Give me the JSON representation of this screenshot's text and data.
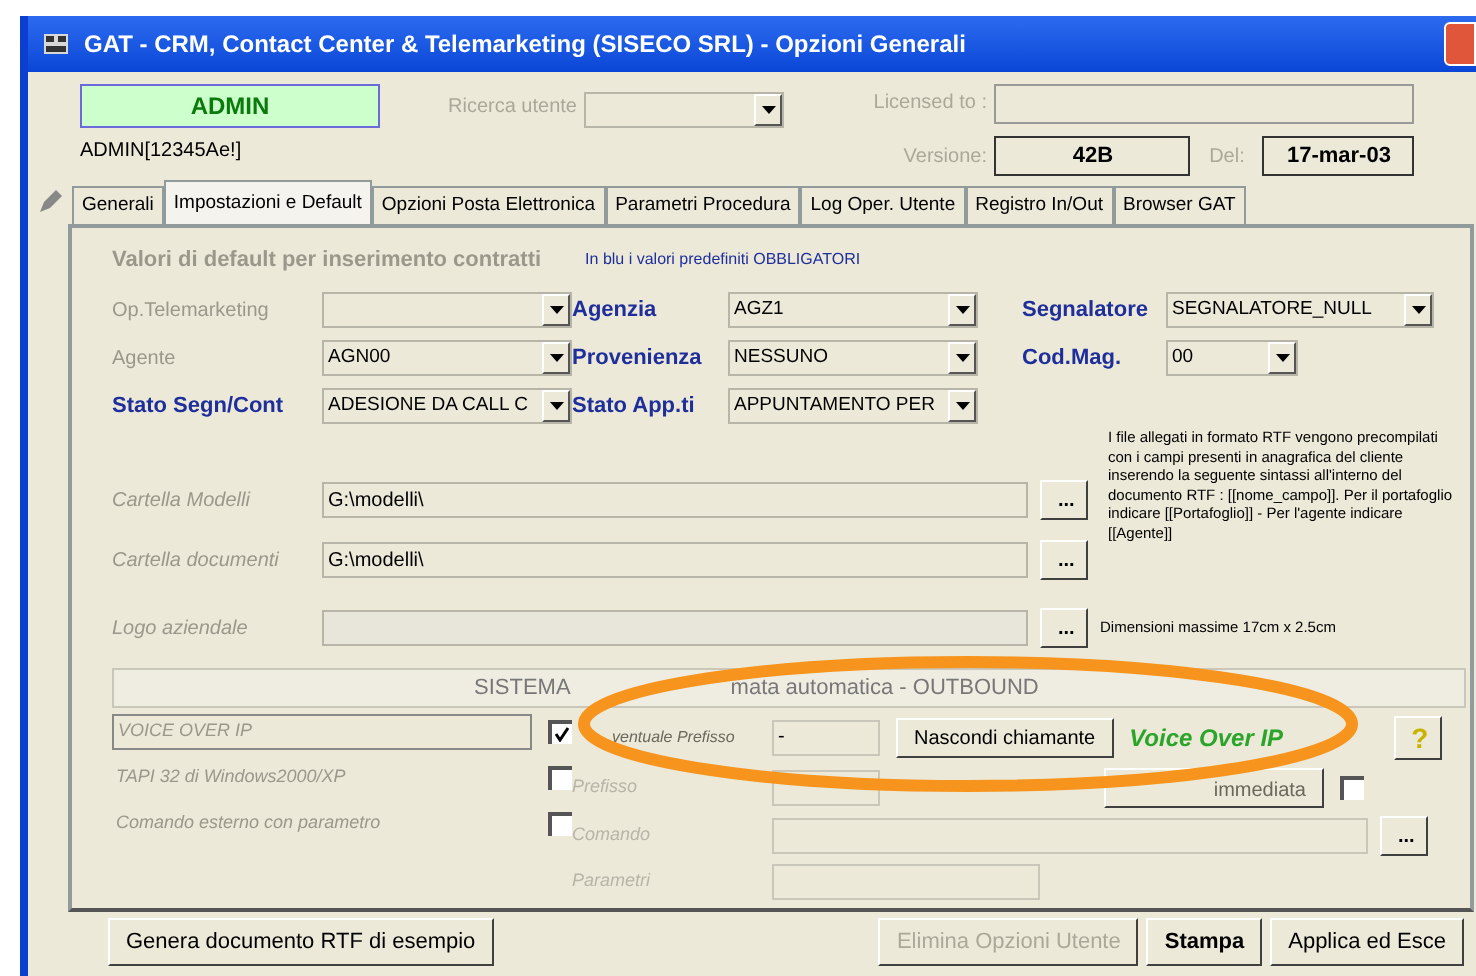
{
  "window": {
    "title": "GAT - CRM, Contact Center & Telemarketing (SISECO SRL) - Opzioni Generali"
  },
  "header": {
    "user_badge": "ADMIN",
    "user_code": "ADMIN[12345Ae!]",
    "search_label": "Ricerca utente",
    "licensed_label": "Licensed to :",
    "version_label": "Versione:",
    "version": "42B",
    "date_label": "Del:",
    "date": "17-mar-03"
  },
  "tabs": [
    {
      "label": "Generali",
      "selected": false
    },
    {
      "label": "Impostazioni e Default",
      "selected": true
    },
    {
      "label": "Opzioni Posta Elettronica",
      "selected": false
    },
    {
      "label": "Parametri Procedura",
      "selected": false
    },
    {
      "label": "Log Oper. Utente",
      "selected": false
    },
    {
      "label": "Registro In/Out",
      "selected": false
    },
    {
      "label": "Browser GAT",
      "selected": false
    }
  ],
  "panel": {
    "heading": "Valori di default per inserimento contratti",
    "required_note": "In blu i valori predefiniti OBBLIGATORI",
    "defaults": [
      {
        "label": "Op.Telemarketing",
        "required": false
      },
      {
        "label": "Agenzia",
        "required": true,
        "value": "AGZ1"
      },
      {
        "label": "Segnalatore",
        "required": true,
        "value": "SEGNALATORE_NULL"
      },
      {
        "label": "Agente",
        "required": false,
        "value": "AGN00"
      },
      {
        "label": "Provenienza",
        "required": true,
        "value": "NESSUNO"
      },
      {
        "label": "Cod.Mag.",
        "required": true,
        "value": "00"
      },
      {
        "label": "Stato Segn/Cont",
        "required": true,
        "value": "ADESIONE DA CALL C"
      },
      {
        "label": "Stato App.ti",
        "required": true,
        "value": "APPUNTAMENTO PER"
      }
    ],
    "rtf_note": "I file allegati in formato RTF vengono precompilati con i campi presenti in anagrafica del cliente inserendo la seguente sintassi all'interno del documento RTF :   [[nome_campo]]. Per il portafoglio indicare [[Portafoglio]] - Per l'agente indicare [[Agente]]",
    "paths": [
      {
        "label": "Cartella Modelli",
        "value": "G:\\modelli\\",
        "button": "..."
      },
      {
        "label": "Cartella documenti",
        "value": "G:\\modelli\\",
        "button": "..."
      },
      {
        "label": "Logo aziendale",
        "button": "...",
        "disabled": true,
        "note": "Dimensioni massime 17cm x 2.5cm"
      }
    ],
    "outbound": {
      "title_parts": [
        "SISTEMA",
        "mata automatica - OUTBOUND"
      ],
      "modes": [
        {
          "label": "VOICE OVER IP",
          "checked": true
        },
        {
          "label": "TAPI 32 di Windows2000/XP",
          "checked": false
        },
        {
          "label": "Comando esterno con parametro",
          "checked": false
        }
      ],
      "prefix_label": "ventuale Prefisso",
      "prefix_value": "-",
      "hide_caller_button": "Nascondi chiamante",
      "mode_name": "Voice Over IP",
      "help_button": "?",
      "prefix2_label": "Prefisso",
      "immediate_button": "immediata",
      "immediate_checked": false,
      "command_label": "Comando",
      "command_button": "...",
      "params_label": "Parametri"
    }
  },
  "footer": [
    {
      "label": "Genera documento RTF di esempio",
      "disabled": false,
      "default": false
    },
    {
      "label": "Elimina Opzioni Utente",
      "disabled": true,
      "default": false
    },
    {
      "label": "Stampa",
      "disabled": false,
      "default": true
    },
    {
      "label": "Applica ed Esce",
      "disabled": false,
      "default": false
    }
  ]
}
